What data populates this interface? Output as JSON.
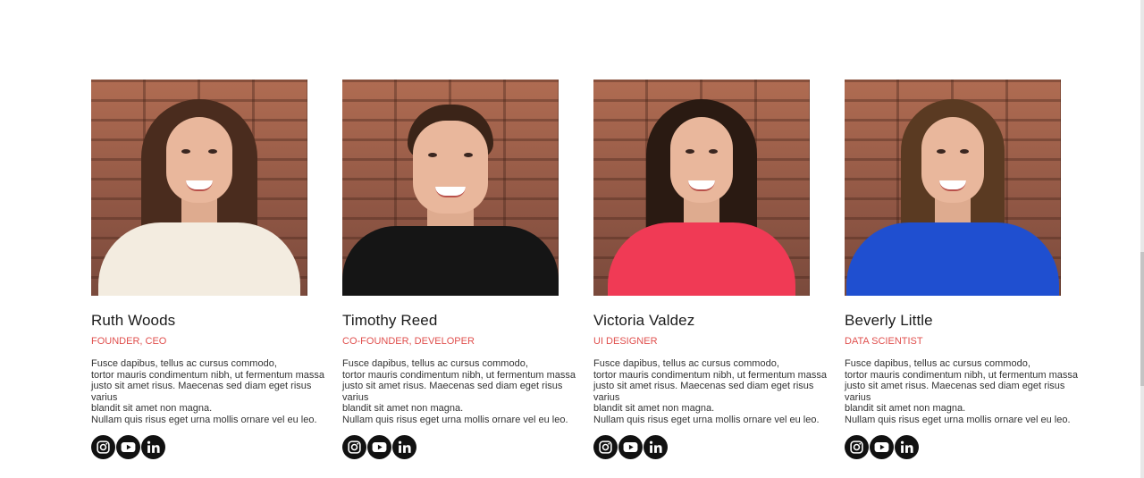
{
  "team": {
    "members": [
      {
        "name": "Ruth Woods",
        "role": "FOUNDER, CEO",
        "bio": [
          "Fusce dapibus, tellus ac cursus commodo,",
          "tortor mauris condimentum nibh, ut fermentum massa",
          "justo sit amet risus. Maecenas sed diam eget risus",
          "varius",
          "blandit sit amet non magna.",
          "Nullam quis risus eget urna mollis ornare vel eu leo."
        ],
        "hair_color": "#4a2c1e",
        "top_color": "#f3ece0",
        "social": [
          "instagram-icon",
          "youtube-icon",
          "linkedin-icon"
        ]
      },
      {
        "name": "Timothy Reed",
        "role": "CO-FOUNDER, DEVELOPER",
        "bio": [
          "Fusce dapibus, tellus ac cursus commodo,",
          "tortor mauris condimentum nibh, ut fermentum massa",
          "justo sit amet risus. Maecenas sed diam eget risus",
          "varius",
          "blandit sit amet non magna.",
          "Nullam quis risus eget urna mollis ornare vel eu leo."
        ],
        "hair_color": "#3b2418",
        "top_color": "#151515",
        "social": [
          "instagram-icon",
          "youtube-icon",
          "linkedin-icon"
        ]
      },
      {
        "name": "Victoria Valdez",
        "role": "UI DESIGNER",
        "bio": [
          "Fusce dapibus, tellus ac cursus commodo,",
          "tortor mauris condimentum nibh, ut fermentum massa",
          "justo sit amet risus. Maecenas sed diam eget risus",
          "varius",
          "blandit sit amet non magna.",
          "Nullam quis risus eget urna mollis ornare vel eu leo."
        ],
        "hair_color": "#2a1a12",
        "top_color": "#f03a55",
        "social": [
          "instagram-icon",
          "youtube-icon",
          "linkedin-icon"
        ]
      },
      {
        "name": "Beverly Little",
        "role": "DATA SCIENTIST",
        "bio": [
          "Fusce dapibus, tellus ac cursus commodo,",
          "tortor mauris condimentum nibh, ut fermentum massa",
          "justo sit amet risus. Maecenas sed diam eget risus",
          "varius",
          "blandit sit amet non magna.",
          "Nullam quis risus eget urna mollis ornare vel eu leo."
        ],
        "hair_color": "#5a3a22",
        "top_color": "#1f4fd0",
        "social": [
          "instagram-icon",
          "youtube-icon",
          "linkedin-icon"
        ]
      }
    ]
  },
  "colors": {
    "role_accent": "#e0504e",
    "name_text": "#1b1b1b",
    "icon_bg": "#111111"
  }
}
